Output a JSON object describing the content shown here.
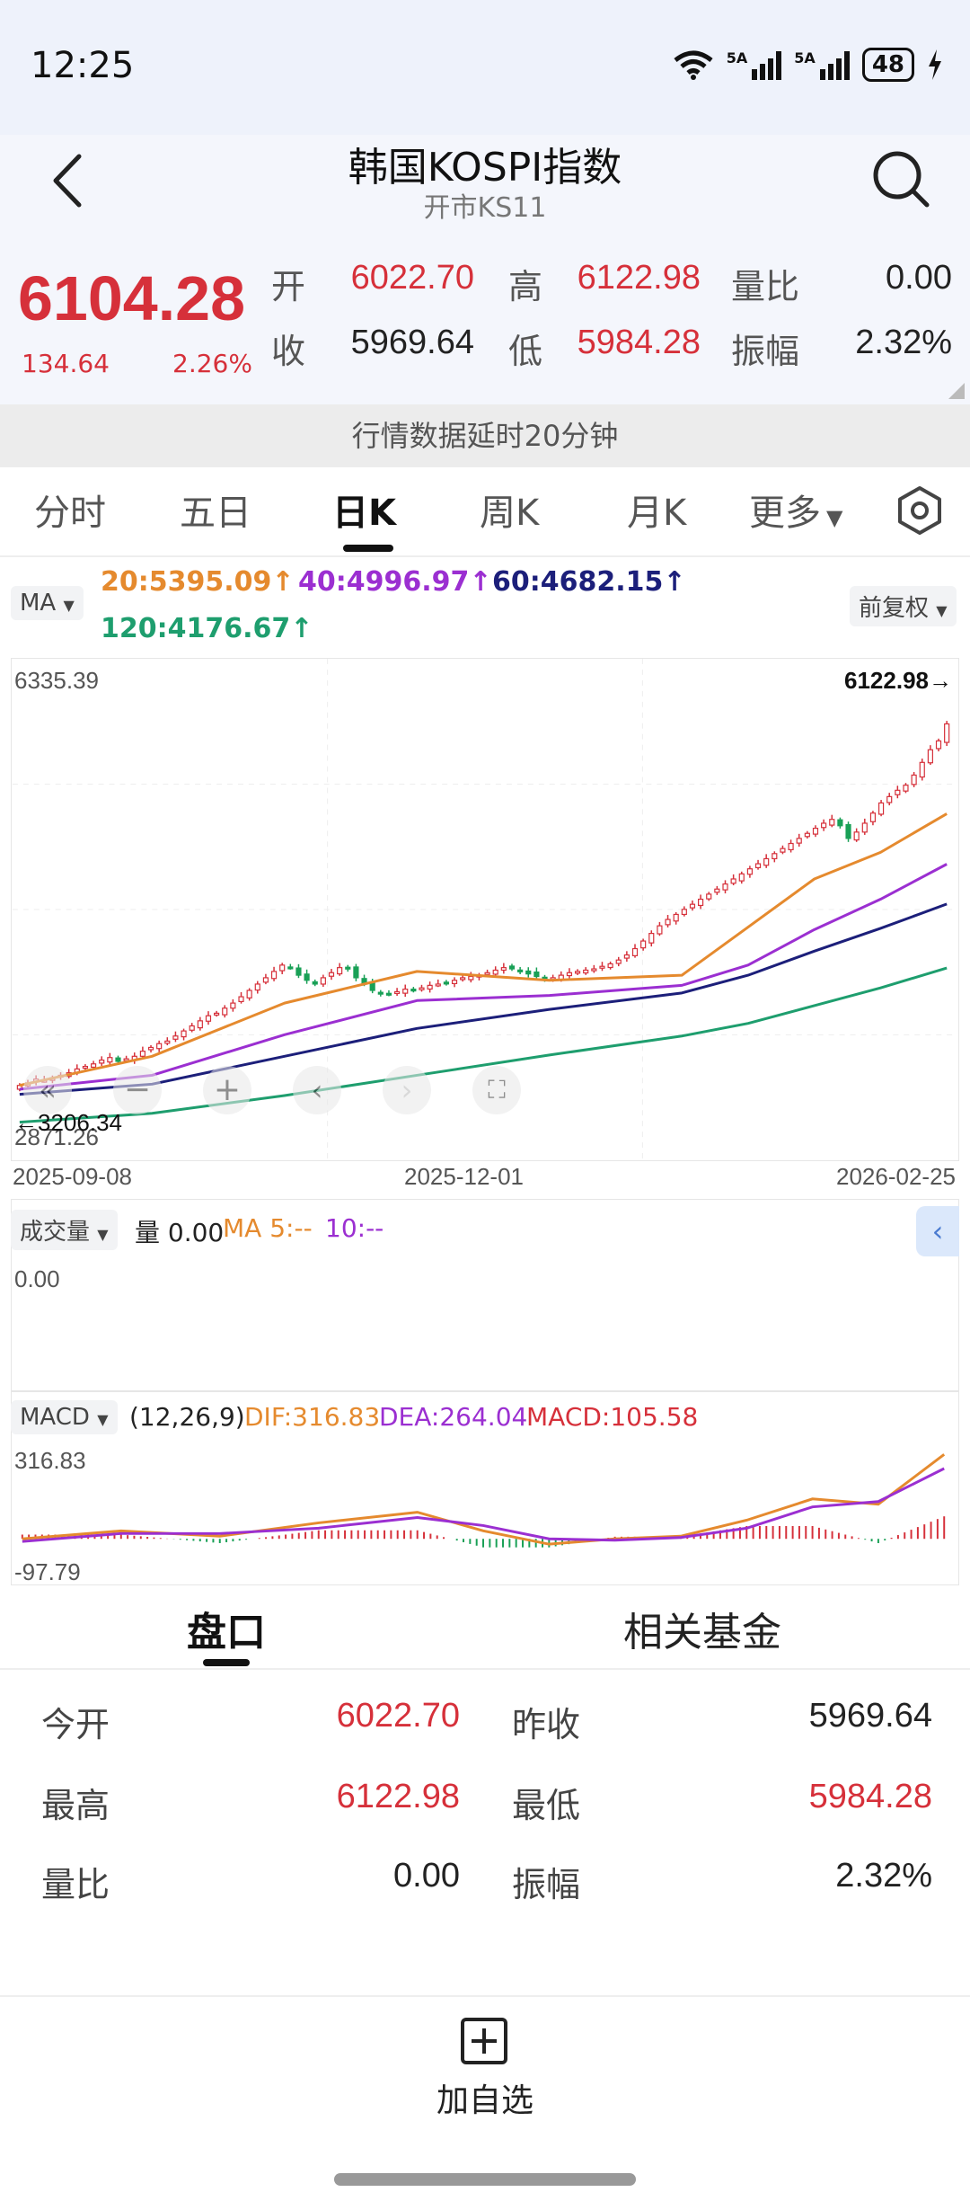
{
  "status_bar": {
    "time": "12:25",
    "battery": "48",
    "signal1": "5A",
    "signal2": "5A"
  },
  "header": {
    "title": "韩国KOSPI指数",
    "subtitle": "开市KS11"
  },
  "quote": {
    "price": "6104.28",
    "change": "134.64",
    "change_pct": "2.26%",
    "open_label": "开",
    "open": "6022.70",
    "high_label": "高",
    "high": "6122.98",
    "vol_ratio_label": "量比",
    "vol_ratio": "0.00",
    "close_label": "收",
    "prev_close": "5969.64",
    "low_label": "低",
    "low": "5984.28",
    "amplitude_label": "振幅",
    "amplitude": "2.32%"
  },
  "delay_notice": "行情数据延时20分钟",
  "tabs": [
    "分时",
    "五日",
    "日K",
    "周K",
    "月K",
    "更多"
  ],
  "ma_legend": {
    "selector": "MA",
    "ma20": "20:5395.09↑",
    "ma40": "40:4996.97↑",
    "ma60": "60:4682.15↑",
    "ma120": "120:4176.67↑",
    "adjust": "前复权"
  },
  "colors": {
    "ma20": "#e58a2e",
    "ma40": "#9b2fd1",
    "ma60": "#1c1f7a",
    "ma120": "#1e9e6e",
    "up": "#d6303a",
    "down": "#19a056"
  },
  "chart_data": [
    {
      "type": "candlestick",
      "ylim": [
        2871.26,
        6335.39
      ],
      "max_label": "6335.39",
      "min_label": "2871.26",
      "high_marker": "6122.98→",
      "low_marker": "←3206.34",
      "x_labels": [
        "2025-09-08",
        "2025-12-01",
        "2026-02-25"
      ],
      "series": [
        {
          "name": "MA20",
          "x": [
            0,
            20,
            40,
            60,
            80,
            100,
            110,
            120,
            130,
            140
          ],
          "values": [
            3250,
            3480,
            3900,
            4150,
            4080,
            4120,
            4500,
            4880,
            5090,
            5395
          ]
        },
        {
          "name": "MA40",
          "x": [
            0,
            20,
            40,
            60,
            80,
            100,
            110,
            120,
            130,
            140
          ],
          "values": [
            3220,
            3330,
            3650,
            3920,
            3960,
            4040,
            4200,
            4480,
            4720,
            4997
          ]
        },
        {
          "name": "MA60",
          "x": [
            0,
            20,
            40,
            60,
            80,
            100,
            110,
            120,
            130,
            140
          ],
          "values": [
            3180,
            3260,
            3480,
            3700,
            3850,
            3980,
            4120,
            4310,
            4490,
            4682
          ]
        },
        {
          "name": "MA120",
          "x": [
            0,
            20,
            40,
            60,
            80,
            100,
            110,
            120,
            130,
            140
          ],
          "values": [
            2960,
            3030,
            3170,
            3330,
            3490,
            3640,
            3740,
            3880,
            4020,
            4177
          ]
        }
      ],
      "close": [
        3250,
        3270,
        3300,
        3290,
        3310,
        3330,
        3350,
        3380,
        3400,
        3420,
        3450,
        3470,
        3440,
        3460,
        3480,
        3520,
        3550,
        3580,
        3600,
        3640,
        3680,
        3720,
        3760,
        3800,
        3820,
        3860,
        3900,
        3950,
        4000,
        4050,
        4100,
        4150,
        4200,
        4180,
        4120,
        4080,
        4050,
        4100,
        4140,
        4180,
        4170,
        4100,
        4050,
        4000,
        3980,
        3970,
        3990,
        4010,
        4000,
        4020,
        4040,
        4050,
        4060,
        4080,
        4100,
        4110,
        4120,
        4140,
        4160,
        4180,
        4170,
        4150,
        4130,
        4110,
        4090,
        4100,
        4120,
        4140,
        4150,
        4160,
        4170,
        4190,
        4210,
        4240,
        4280,
        4330,
        4390,
        4450,
        4510,
        4560,
        4600,
        4640,
        4680,
        4720,
        4760,
        4800,
        4840,
        4880,
        4920,
        4960,
        5000,
        5040,
        5080,
        5120,
        5160,
        5200,
        5240,
        5280,
        5320,
        5350,
        5300,
        5200,
        5250,
        5320,
        5400,
        5480,
        5530,
        5580,
        5620,
        5700,
        5800,
        5900,
        5970,
        6104
      ]
    },
    {
      "type": "bar",
      "title": "成交量",
      "legend": "量 0.00",
      "ma5": "MA 5:--",
      "ma10": "10:--",
      "y_label": "0.00"
    },
    {
      "type": "line",
      "title": "MACD",
      "params": "(12,26,9)",
      "dif": "DIF:316.83",
      "dea": "DEA:264.04",
      "macd": "MACD:105.58",
      "max_label": "316.83",
      "min_label": "-97.79",
      "ylim": [
        -97.79,
        316.83
      ],
      "series": [
        {
          "name": "DIF",
          "x": [
            0,
            15,
            30,
            45,
            60,
            70,
            80,
            90,
            100,
            110,
            120,
            130,
            140
          ],
          "values": [
            0,
            30,
            10,
            60,
            100,
            30,
            -20,
            0,
            10,
            70,
            150,
            130,
            316.83
          ]
        },
        {
          "name": "DEA",
          "x": [
            0,
            15,
            30,
            45,
            60,
            70,
            80,
            90,
            100,
            110,
            120,
            130,
            140
          ],
          "values": [
            -10,
            20,
            20,
            40,
            80,
            50,
            0,
            -5,
            5,
            40,
            120,
            140,
            264.04
          ]
        }
      ]
    }
  ],
  "volume_pane": {
    "title": "成交量",
    "legend": "量 0.00",
    "ma5": "MA 5:--",
    "ma10": "10:--",
    "y_label": "0.00"
  },
  "macd_pane": {
    "title": "MACD",
    "params": "(12,26,9)",
    "dif": "DIF:316.83",
    "dea": "DEA:264.04",
    "macd": "MACD:105.58",
    "max_label": "316.83",
    "min_label": "-97.79"
  },
  "detail_tabs": [
    "盘口",
    "相关基金"
  ],
  "detail": {
    "rows": [
      {
        "k1": "今开",
        "v1": "6022.70",
        "k2": "昨收",
        "v2": "5969.64"
      },
      {
        "k1": "最高",
        "v1": "6122.98",
        "k2": "最低",
        "v2": "5984.28"
      },
      {
        "k1": "量比",
        "v1": "0.00",
        "k2": "振幅",
        "v2": "2.32%"
      }
    ]
  },
  "bottom": {
    "add_label": "加自选"
  }
}
